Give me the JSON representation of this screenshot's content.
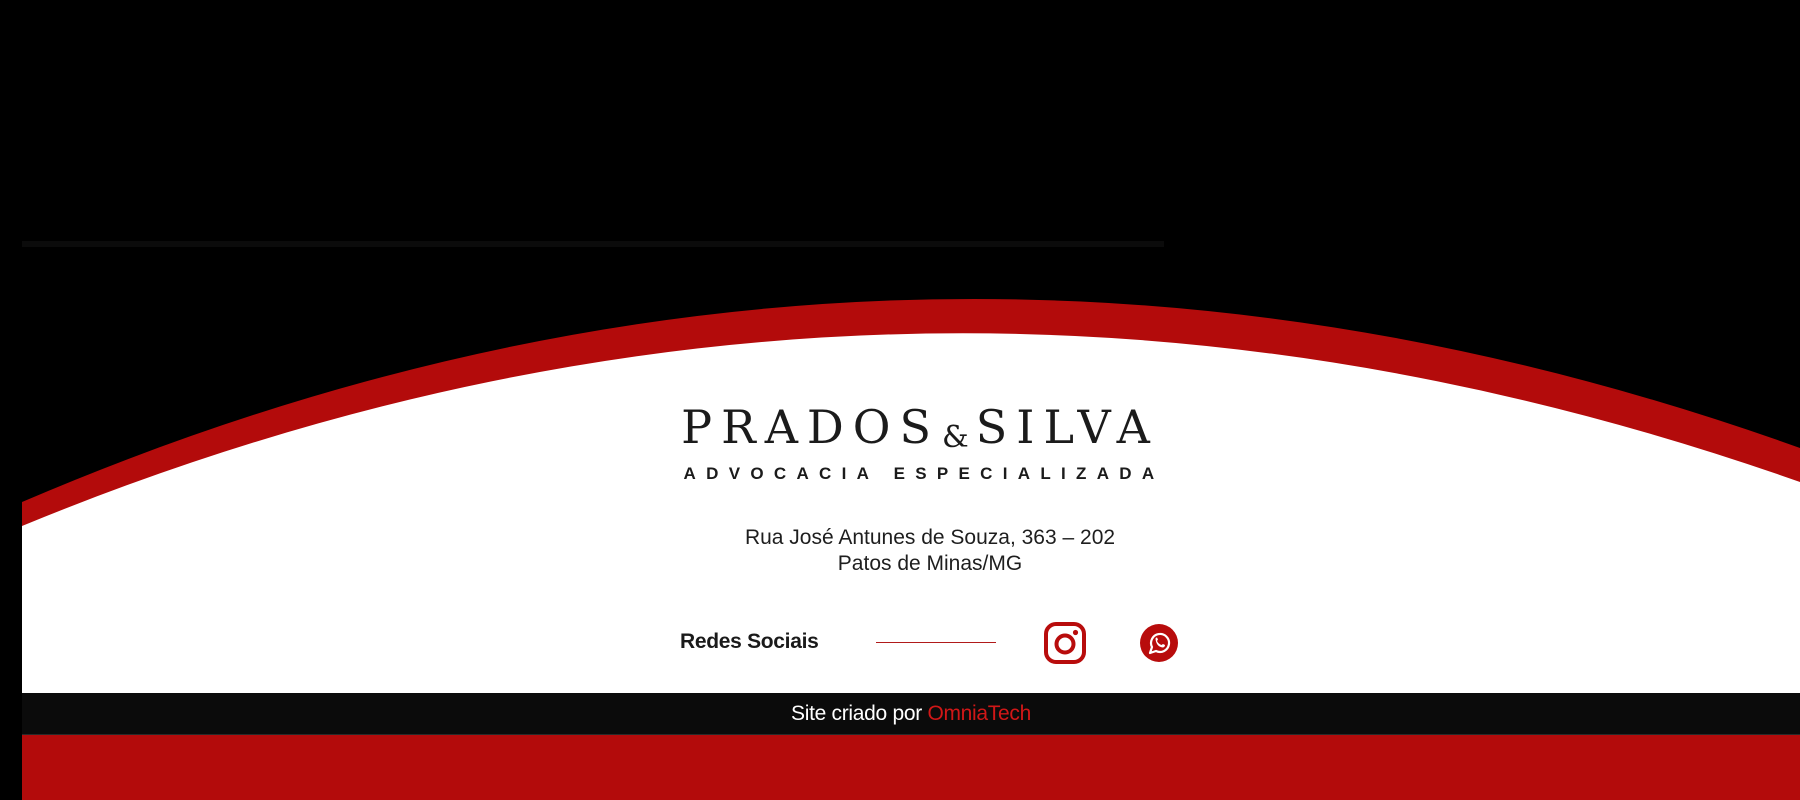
{
  "brand": {
    "name_left": "PRADOS",
    "name_amp": "&",
    "name_right": "SILVA",
    "tagline": "ADVOCACIA ESPECIALIZADA"
  },
  "address": {
    "line1": "Rua José Antunes de Souza, 363 – 202",
    "line2": "Patos de Minas/MG"
  },
  "social": {
    "label": "Redes Sociais",
    "icons": [
      "instagram-icon",
      "whatsapp-icon"
    ]
  },
  "credit": {
    "prefix": "Site criado por ",
    "link_text": "OmniaTech"
  },
  "colors": {
    "background": "#000000",
    "footer": "#ffffff",
    "accent": "#b30b0b",
    "credit_bar": "#0b0b0b"
  }
}
